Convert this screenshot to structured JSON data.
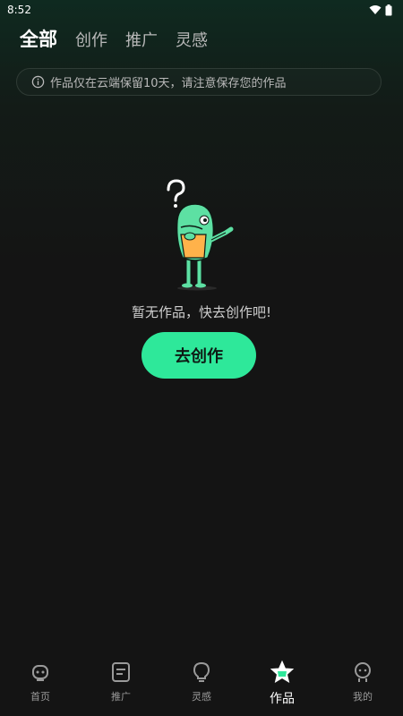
{
  "status": {
    "time": "8:52"
  },
  "tabs": [
    {
      "label": "全部",
      "active": true
    },
    {
      "label": "创作",
      "active": false
    },
    {
      "label": "推广",
      "active": false
    },
    {
      "label": "灵感",
      "active": false
    }
  ],
  "notice": {
    "text": "作品仅在云端保留10天，请注意保存您的作品"
  },
  "empty": {
    "text": "暂无作品，快去创作吧!"
  },
  "create_button": {
    "label": "去创作"
  },
  "nav": [
    {
      "label": "首页",
      "icon": "robot-face-icon",
      "active": false
    },
    {
      "label": "推广",
      "icon": "document-icon",
      "active": false
    },
    {
      "label": "灵感",
      "icon": "lightbulb-icon",
      "active": false
    },
    {
      "label": "作品",
      "icon": "star-icon",
      "active": true
    },
    {
      "label": "我的",
      "icon": "profile-icon",
      "active": false
    }
  ],
  "colors": {
    "accent": "#2ee89a",
    "background": "#141414"
  }
}
